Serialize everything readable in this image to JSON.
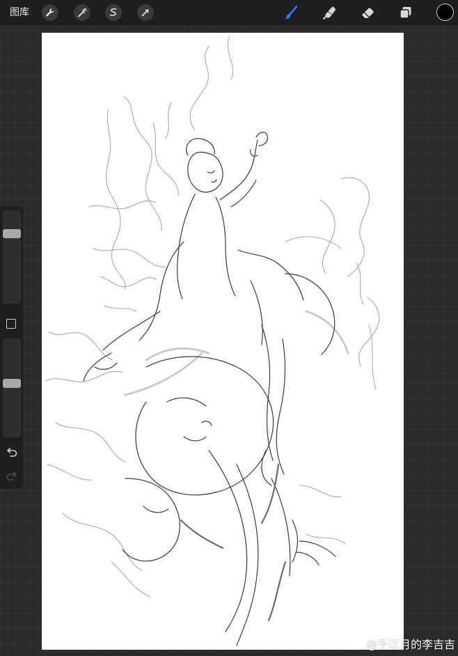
{
  "topbar": {
    "gallery_label": "图库",
    "left_tools": [
      "wrench-icon",
      "magic-wand-icon",
      "selection-icon",
      "transform-arrow-icon"
    ],
    "right_tools": [
      "brush-icon",
      "smudge-icon",
      "eraser-icon",
      "layers-icon"
    ],
    "active_tool": "brush-icon",
    "active_tool_color": "#2f7bf6",
    "current_color": "#000000"
  },
  "sidebar": {
    "brush_size_level": 0.78,
    "opacity_level": 0.55,
    "controls": [
      "modify-button",
      "undo-icon",
      "redo-icon"
    ]
  },
  "canvas": {
    "background": "#ffffff",
    "content": "pencil-sketch"
  },
  "watermark": {
    "text": "@千江月的李吉吉",
    "icon": "weibo-icon"
  }
}
